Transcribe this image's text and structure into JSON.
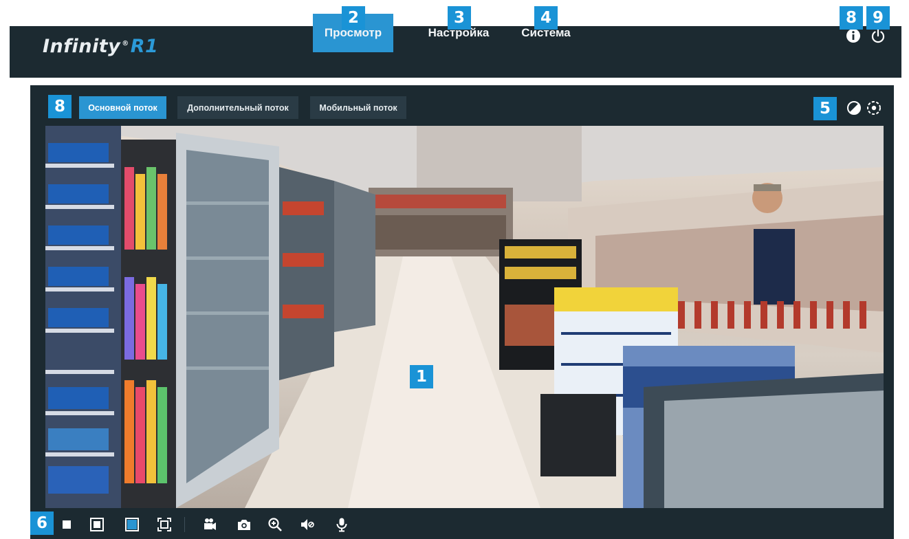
{
  "header": {
    "logo_main": "Infinity",
    "logo_reg": "®",
    "logo_model": "R1",
    "nav": [
      {
        "label": "Просмотр",
        "active": true
      },
      {
        "label": "Настройка",
        "active": false
      },
      {
        "label": "Система",
        "active": false
      }
    ],
    "icons": [
      "info-icon",
      "power-icon"
    ]
  },
  "streams": {
    "tabs": [
      {
        "label": "Основной поток",
        "active": true
      },
      {
        "label": "Дополнительный поток",
        "active": false
      },
      {
        "label": "Мобильный поток",
        "active": false
      }
    ],
    "icons": [
      "contrast-icon",
      "ptz-settings-icon"
    ]
  },
  "toolbar": {
    "icons": [
      "stop-icon",
      "aspect-original-icon",
      "aspect-fit-icon",
      "fullscreen-icon",
      "record-video-icon",
      "snapshot-icon",
      "digital-zoom-icon",
      "audio-mute-icon",
      "microphone-icon"
    ],
    "active_icon": "aspect-fit-icon"
  },
  "callouts": {
    "video": "1",
    "nav_view": "2",
    "nav_settings": "3",
    "nav_system": "4",
    "image_tools": "5",
    "toolbar": "6",
    "stream_tabs": "8",
    "info": "8",
    "power": "9"
  },
  "colors": {
    "accent": "#2a95d2",
    "badge": "#1a93d6",
    "panel": "#1c2a31",
    "inactive_tab": "#2a3b45"
  }
}
